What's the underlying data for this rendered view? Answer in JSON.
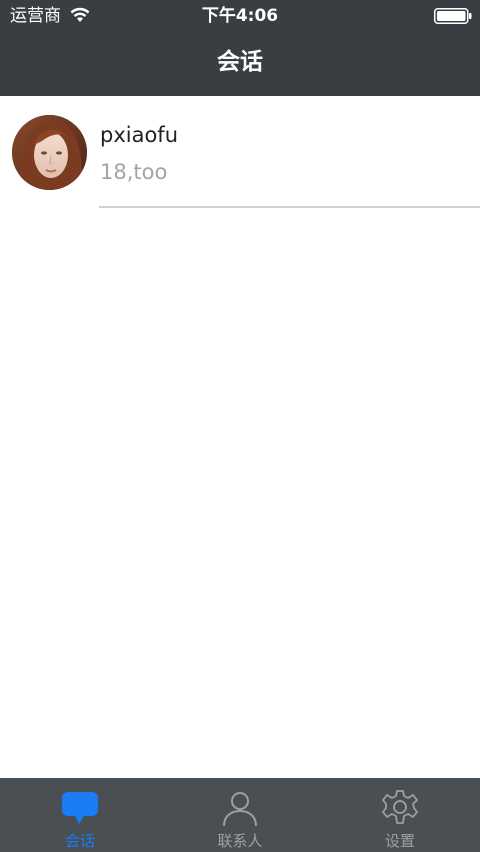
{
  "status_bar": {
    "carrier": "运营商",
    "time": "下午4:06",
    "wifi_icon": "wifi-icon",
    "battery_icon": "battery-icon"
  },
  "nav": {
    "title": "会话"
  },
  "conversations": [
    {
      "name": "pxiaofu",
      "last_message": "18,too",
      "avatar_icon": "avatar"
    }
  ],
  "tab_bar": {
    "tabs": [
      {
        "label": "会话",
        "icon": "chat-bubble-icon",
        "active": true
      },
      {
        "label": "联系人",
        "icon": "person-icon",
        "active": false
      },
      {
        "label": "设置",
        "icon": "gear-icon",
        "active": false
      }
    ]
  },
  "colors": {
    "bar_background": "#3a3e42",
    "tab_background": "#4a4f54",
    "accent": "#1a7cf2",
    "inactive": "#9ba0a5",
    "secondary_text": "#a4a4a4"
  }
}
